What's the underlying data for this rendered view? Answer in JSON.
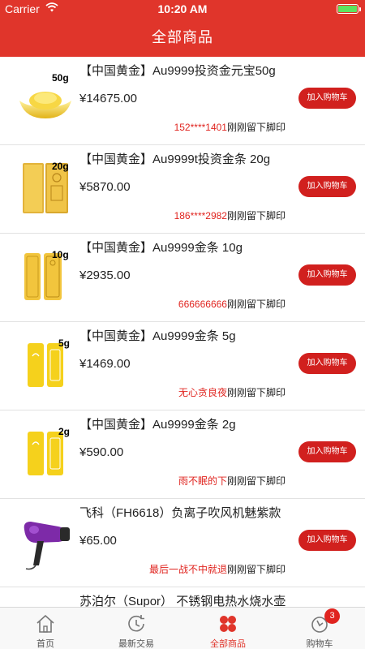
{
  "status_bar": {
    "carrier": "Carrier",
    "time": "10:20 AM"
  },
  "nav": {
    "title": "全部商品"
  },
  "colors": {
    "brand_red": "#e0352b",
    "button_red": "#d1201e",
    "highlight_red": "#e0241f",
    "battery_green": "#5ee35e"
  },
  "products": [
    {
      "name": "【中国黄金】Au9999投资金元宝50g",
      "price": "¥14675.00",
      "weight_tag": "50g",
      "icon": "gold-ingot-icon",
      "buy_label": "加入购物车",
      "footprint_user": "152****1401",
      "footprint_text": "刚刚留下脚印"
    },
    {
      "name": "【中国黄金】Au9999t投资金条 20g",
      "price": "¥5870.00",
      "weight_tag": "20g",
      "icon": "gold-bar-icon",
      "buy_label": "加入购物车",
      "footprint_user": "186****2982",
      "footprint_text": "刚刚留下脚印"
    },
    {
      "name": "【中国黄金】Au9999金条 10g",
      "price": "¥2935.00",
      "weight_tag": "10g",
      "icon": "gold-bar-icon",
      "buy_label": "加入购物车",
      "footprint_user": "666666666",
      "footprint_text": "刚刚留下脚印"
    },
    {
      "name": "【中国黄金】Au9999金条 5g",
      "price": "¥1469.00",
      "weight_tag": "5g",
      "icon": "gold-bar-pair-icon",
      "buy_label": "加入购物车",
      "footprint_user": "无心贪良夜",
      "footprint_text": "刚刚留下脚印"
    },
    {
      "name": "【中国黄金】Au9999金条 2g",
      "price": "¥590.00",
      "weight_tag": "2g",
      "icon": "gold-bar-pair-icon",
      "buy_label": "加入购物车",
      "footprint_user": "雨不眠的下",
      "footprint_text": "刚刚留下脚印"
    },
    {
      "name": "飞科（FH6618）负离子吹风机魅紫款",
      "price": "¥65.00",
      "weight_tag": "",
      "icon": "hair-dryer-icon",
      "buy_label": "加入购物车",
      "footprint_user": "最后一战不中就退",
      "footprint_text": "刚刚留下脚印"
    },
    {
      "name": "苏泊尔（Supor） 不锈钢电热水烧水壶",
      "price": "",
      "weight_tag": "",
      "icon": "kettle-icon",
      "buy_label": "",
      "footprint_user": "",
      "footprint_text": ""
    }
  ],
  "tabs": [
    {
      "label": "首页",
      "icon": "home-icon",
      "active": false
    },
    {
      "label": "最新交易",
      "icon": "clock-refresh-icon",
      "active": false
    },
    {
      "label": "全部商品",
      "icon": "four-petal-grid-icon",
      "active": true
    },
    {
      "label": "购物车",
      "icon": "cart-icon",
      "active": false,
      "badge": "3"
    }
  ]
}
